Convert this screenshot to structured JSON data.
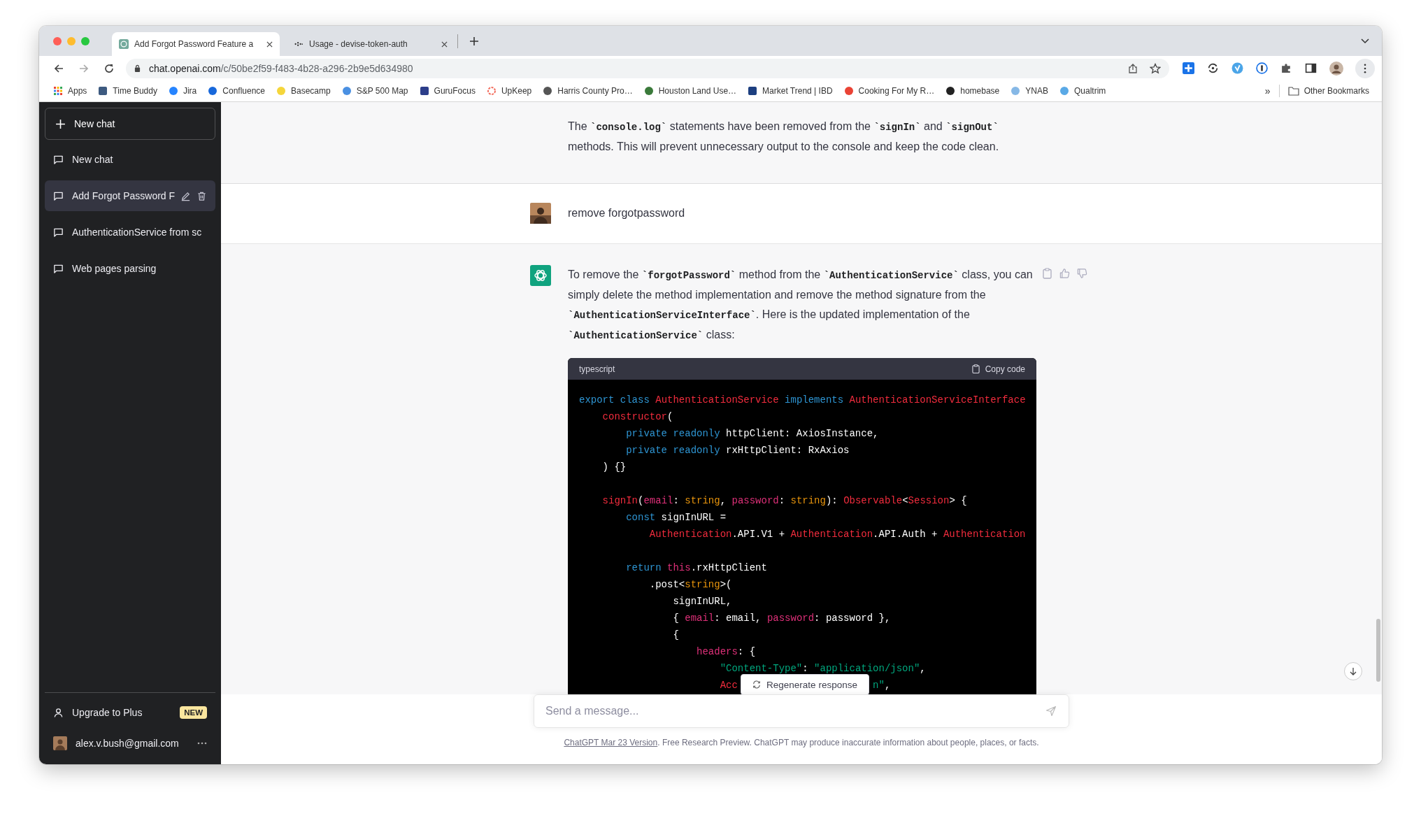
{
  "browser": {
    "tabs": [
      {
        "title": "Add Forgot Password Feature a",
        "selected": true
      },
      {
        "title": "Usage - devise-token-auth",
        "selected": false
      }
    ],
    "address": {
      "host": "chat.openai.com",
      "path": "/c/50be2f59-f483-4b28-a296-2b9e5d634980"
    },
    "bookmarks": [
      "Apps",
      "Time Buddy",
      "Jira",
      "Confluence",
      "Basecamp",
      "S&P 500 Map",
      "GuruFocus",
      "UpKeep",
      "Harris County Pro…",
      "Houston Land Use…",
      "Market Trend | IBD",
      "Cooking For My R…",
      "homebase",
      "YNAB",
      "Qualtrim"
    ],
    "bookmarks_overflow": "»",
    "other_bookmarks": "Other Bookmarks"
  },
  "sidebar": {
    "new_chat": "New chat",
    "chats": [
      {
        "title": "New chat",
        "selected": false
      },
      {
        "title": "Add Forgot Password F",
        "selected": true
      },
      {
        "title": "AuthenticationService from sc",
        "selected": false
      },
      {
        "title": "Web pages parsing",
        "selected": false
      }
    ],
    "upgrade": {
      "label": "Upgrade to Plus",
      "badge": "NEW"
    },
    "user": {
      "email": "alex.v.bush@gmail.com"
    }
  },
  "messages": [
    {
      "kind": "assistant",
      "actions": false,
      "paragraphs": [
        [
          {
            "t": "The "
          },
          {
            "t": "`console.log`",
            "code": true
          },
          {
            "t": " statements have been removed from the "
          },
          {
            "t": "`signIn`",
            "code": true
          },
          {
            "t": " and "
          },
          {
            "t": "`signOut`",
            "code": true
          },
          {
            "t": " methods. This will prevent unnecessary output to the console and keep the code clean."
          }
        ]
      ]
    },
    {
      "kind": "user",
      "actions": false,
      "paragraphs": [
        [
          {
            "t": "remove forgotpassword"
          }
        ]
      ]
    },
    {
      "kind": "assistant",
      "actions": true,
      "paragraphs": [
        [
          {
            "t": "To remove the "
          },
          {
            "t": "`forgotPassword`",
            "code": true
          },
          {
            "t": " method from the "
          },
          {
            "t": "`AuthenticationService`",
            "code": true
          },
          {
            "t": " class, you can simply delete the method implementation and remove the method signature from the "
          },
          {
            "t": "`AuthenticationServiceInterface`",
            "code": true
          },
          {
            "t": ". Here is the updated implementation of the "
          },
          {
            "t": "`AuthenticationService`",
            "code": true
          },
          {
            "t": " class:"
          }
        ]
      ],
      "code": {
        "language": "typescript",
        "copy_label": "Copy code",
        "lines": [
          {
            "kind": "code",
            "tokens": [
              {
                "t": "export class",
                "kind": "kw"
              },
              {
                "t": " AuthenticationService",
                "kind": "cls"
              },
              {
                "t": " implements",
                "kind": "kw"
              },
              {
                "t": " AuthenticationServiceInterface",
                "kind": "cls"
              }
            ]
          },
          {
            "kind": "code",
            "tokens": [
              {
                "t": "    constructor",
                "kind": "cls"
              },
              {
                "t": "(",
                "kind": "p"
              }
            ]
          },
          {
            "kind": "code",
            "tokens": [
              {
                "t": "        private readonly",
                "kind": "kw"
              },
              {
                "t": " httpClient: AxiosInstance,",
                "kind": "p"
              }
            ]
          },
          {
            "kind": "code",
            "tokens": [
              {
                "t": "        private readonly",
                "kind": "kw"
              },
              {
                "t": " rxHttpClient: RxAxios",
                "kind": "p"
              }
            ]
          },
          {
            "kind": "code",
            "tokens": [
              {
                "t": "    ) {}",
                "kind": "p"
              }
            ]
          },
          {
            "kind": "blank"
          },
          {
            "kind": "code",
            "tokens": [
              {
                "t": "    signIn",
                "kind": "cls"
              },
              {
                "t": "(",
                "kind": "p"
              },
              {
                "t": "email",
                "kind": "prop"
              },
              {
                "t": ": ",
                "kind": "p"
              },
              {
                "t": "string",
                "kind": "type"
              },
              {
                "t": ", ",
                "kind": "p"
              },
              {
                "t": "password",
                "kind": "prop"
              },
              {
                "t": ": ",
                "kind": "p"
              },
              {
                "t": "string",
                "kind": "type"
              },
              {
                "t": "): ",
                "kind": "p"
              },
              {
                "t": "Observable",
                "kind": "cls"
              },
              {
                "t": "<",
                "kind": "p"
              },
              {
                "t": "Session",
                "kind": "cls"
              },
              {
                "t": "> {",
                "kind": "p"
              }
            ]
          },
          {
            "kind": "code",
            "tokens": [
              {
                "t": "        const",
                "kind": "kw"
              },
              {
                "t": " signInURL =",
                "kind": "p"
              }
            ]
          },
          {
            "kind": "code",
            "tokens": [
              {
                "t": "            Authentication",
                "kind": "cls"
              },
              {
                "t": ".API.V1 + ",
                "kind": "p"
              },
              {
                "t": "Authentication",
                "kind": "cls"
              },
              {
                "t": ".API.Auth + ",
                "kind": "p"
              },
              {
                "t": "Authentication",
                "kind": "cls"
              }
            ]
          },
          {
            "kind": "blank"
          },
          {
            "kind": "code",
            "tokens": [
              {
                "t": "        return",
                "kind": "kw"
              },
              {
                "t": " this",
                "kind": "prop"
              },
              {
                "t": ".rxHttpClient",
                "kind": "p"
              }
            ]
          },
          {
            "kind": "code",
            "tokens": [
              {
                "t": "            .post<",
                "kind": "p"
              },
              {
                "t": "string",
                "kind": "type"
              },
              {
                "t": ">(",
                "kind": "p"
              }
            ]
          },
          {
            "kind": "code",
            "tokens": [
              {
                "t": "                signInURL,",
                "kind": "p"
              }
            ]
          },
          {
            "kind": "code",
            "tokens": [
              {
                "t": "                { ",
                "kind": "p"
              },
              {
                "t": "email",
                "kind": "prop"
              },
              {
                "t": ": email, ",
                "kind": "p"
              },
              {
                "t": "password",
                "kind": "prop"
              },
              {
                "t": ": password },",
                "kind": "p"
              }
            ]
          },
          {
            "kind": "code",
            "tokens": [
              {
                "t": "                {",
                "kind": "p"
              }
            ]
          },
          {
            "kind": "code",
            "tokens": [
              {
                "t": "                    headers",
                "kind": "prop"
              },
              {
                "t": ": {",
                "kind": "p"
              }
            ]
          },
          {
            "kind": "code",
            "tokens": [
              {
                "t": "                        \"Content-Type\"",
                "kind": "str"
              },
              {
                "t": ": ",
                "kind": "p"
              },
              {
                "t": "\"application/json\"",
                "kind": "str"
              },
              {
                "t": ",",
                "kind": "p"
              }
            ]
          },
          {
            "kind": "covered",
            "before": [
              {
                "t": "                        Acc",
                "kind": "cls"
              }
            ],
            "after": [
              {
                "t": "n\"",
                "kind": "str"
              },
              {
                "t": ",",
                "kind": "p"
              }
            ]
          }
        ]
      }
    }
  ],
  "composer": {
    "regenerate": "Regenerate response",
    "placeholder": "Send a message..."
  },
  "footer": {
    "link": "ChatGPT Mar 23 Version",
    "text": ". Free Research Preview. ChatGPT may produce inaccurate information about people, places, or facts."
  }
}
